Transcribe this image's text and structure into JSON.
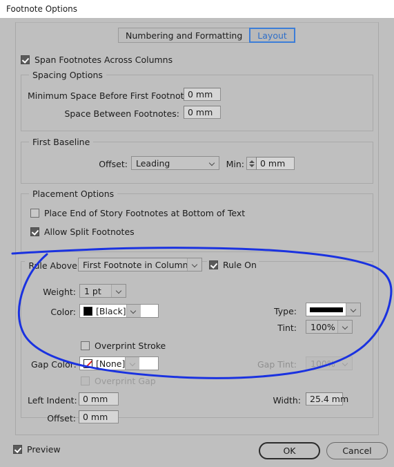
{
  "window": {
    "title": "Footnote Options"
  },
  "tabs": [
    {
      "label": "Numbering and Formatting",
      "active": false
    },
    {
      "label": "Layout",
      "active": true
    }
  ],
  "span_footnotes": {
    "label": "Span Footnotes Across Columns",
    "checked": true
  },
  "spacing_options": {
    "title": "Spacing Options",
    "min_space_label": "Minimum Space Before First Footnote:",
    "min_space_value": "0 mm",
    "between_label": "Space Between Footnotes:",
    "between_value": "0 mm"
  },
  "first_baseline": {
    "title": "First Baseline",
    "offset_label": "Offset:",
    "offset_value": "Leading",
    "min_label": "Min:",
    "min_value": "0 mm"
  },
  "placement_options": {
    "title": "Placement Options",
    "place_end_label": "Place End of Story Footnotes at Bottom of Text",
    "place_end_checked": false,
    "allow_split_label": "Allow Split Footnotes",
    "allow_split_checked": true
  },
  "rule_above": {
    "label": "Rule Above:",
    "value": "First Footnote in Column",
    "rule_on_label": "Rule On",
    "rule_on_checked": true,
    "weight_label": "Weight:",
    "weight_value": "1 pt",
    "color_label": "Color:",
    "color_value": "[Black]",
    "color_swatch": "#000000",
    "overprint_stroke_label": "Overprint Stroke",
    "overprint_stroke_checked": false,
    "gap_color_label": "Gap Color:",
    "gap_color_value": "[None]",
    "overprint_gap_label": "Overprint Gap",
    "overprint_gap_checked": false,
    "overprint_gap_disabled": true,
    "type_label": "Type:",
    "type_value": "solid-line",
    "tint_label": "Tint:",
    "tint_value": "100%",
    "gap_tint_label": "Gap Tint:",
    "gap_tint_value": "100%",
    "gap_tint_disabled": true,
    "left_indent_label": "Left Indent:",
    "left_indent_value": "0 mm",
    "offset_label": "Offset:",
    "offset_value": "0 mm",
    "width_label": "Width:",
    "width_value": "25.4 mm"
  },
  "footer": {
    "preview_label": "Preview",
    "preview_checked": true,
    "ok_label": "OK",
    "cancel_label": "Cancel"
  },
  "annotation": {
    "type": "freehand-ellipse",
    "color": "#1a32e0"
  }
}
